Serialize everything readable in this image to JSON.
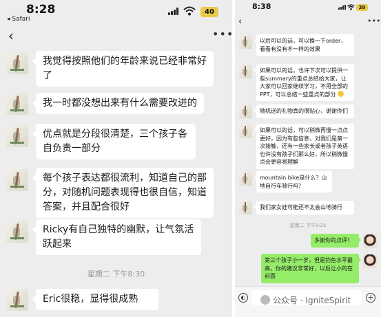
{
  "left_phone": {
    "status": {
      "time": "8:28",
      "back_app": "◂ Safari",
      "battery": "40"
    },
    "nav": {
      "back": "‹",
      "more": "•••"
    },
    "messages": [
      {
        "text": "我觉得按照他们的年龄来说已经非常好了"
      },
      {
        "text": "我一时都没想出来有什么需要改进的"
      },
      {
        "text": "优点就是分段很清楚，三个孩子各自负责一部分"
      },
      {
        "text": "每个孩子表达都很流利，知道自己的部分，对随机问题表现得也很自信，知道答案，并且配合很好"
      },
      {
        "text": "Ricky有自己独特的幽默，让气氛活跃起来"
      },
      {
        "text": "Eric很稳，显得很成熟"
      }
    ],
    "timestamp": "星期二 下午8:30"
  },
  "right_phone": {
    "status": {
      "time": "8:38",
      "battery": "39"
    },
    "nav": {
      "back": "‹",
      "more": "•••"
    },
    "messages_in": [
      {
        "text": "以后可以的话，可以换一下order，看看有没有不一样的效果"
      },
      {
        "text": "如果可以的话，也许下次可以提供一些summary的重点总结给大家，让大家可以回家继续学习，不用全部的PPT，可以总结一些重点的部分"
      },
      {
        "text": "随机送的礼物真的很贴心，谢谢你们"
      },
      {
        "text": "如果可以的话，可以稍微再慢一点点更好，因为有些信息，对我们是第一次接触，还有一些家长或者孩子英语也许没有孩子们那么好，所以稍微慢点会更容易理解"
      },
      {
        "text": "mountain bike是什么？山地自行车骑行吗？"
      },
      {
        "text": "我们家女娃可能还不太会山地骑行"
      }
    ],
    "timestamp": "星期二 下午9:25",
    "messages_out": [
      {
        "text": "多谢你的点评！"
      },
      {
        "text": "第三个孩子小一岁，但是钓鱼水平最高，你的建议非常好，以后让小的在前面"
      }
    ]
  },
  "watermark": "公众号 · IgniteSpirit"
}
